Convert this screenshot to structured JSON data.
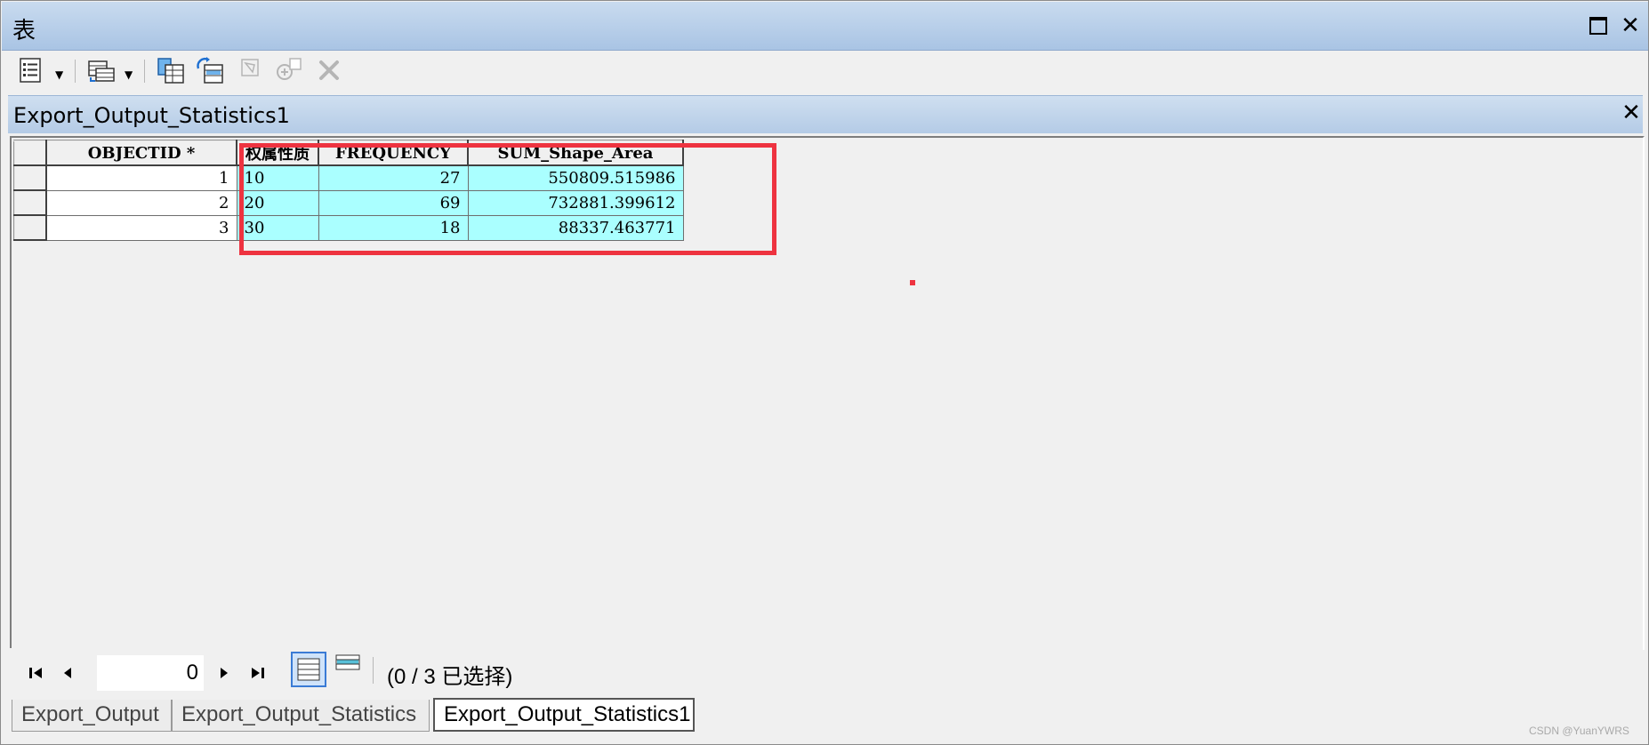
{
  "window": {
    "title": "表"
  },
  "toolbar": {
    "buttons": [
      {
        "name": "table-options",
        "icon": "table-options-icon"
      },
      {
        "name": "related-tables",
        "icon": "related-tables-icon"
      },
      {
        "name": "select-by-attributes",
        "icon": "select-by-attributes-icon"
      },
      {
        "name": "switch-selection",
        "icon": "switch-selection-icon"
      },
      {
        "name": "clear-selection",
        "icon": "clear-selection-icon"
      },
      {
        "name": "zoom-to-selected",
        "icon": "zoom-to-selected-icon"
      },
      {
        "name": "delete-selected",
        "icon": "delete-icon"
      }
    ]
  },
  "table_window": {
    "title": "Export_Output_Statistics1"
  },
  "grid": {
    "columns": [
      "OBJECTID *",
      "权属性质",
      "FREQUENCY",
      "SUM_Shape_Area"
    ],
    "rows": [
      {
        "objectid": "1",
        "nature": "10",
        "frequency": "27",
        "sum_area": "550809.515986"
      },
      {
        "objectid": "2",
        "nature": "20",
        "frequency": "69",
        "sum_area": "732881.399612"
      },
      {
        "objectid": "3",
        "nature": "30",
        "frequency": "18",
        "sum_area": "88337.463771"
      }
    ],
    "highlight_color": "#aaffff",
    "annotation_color": "#ee3340"
  },
  "navigation": {
    "current_record": "0",
    "selection_info": "(0 / 3 已选择)"
  },
  "tabs": [
    "Export_Output",
    "Export_Output_Statistics",
    "Export_Output_Statistics1"
  ],
  "active_tab": "Export_Output_Statistics1",
  "watermark": "CSDN @YuanYWRS"
}
